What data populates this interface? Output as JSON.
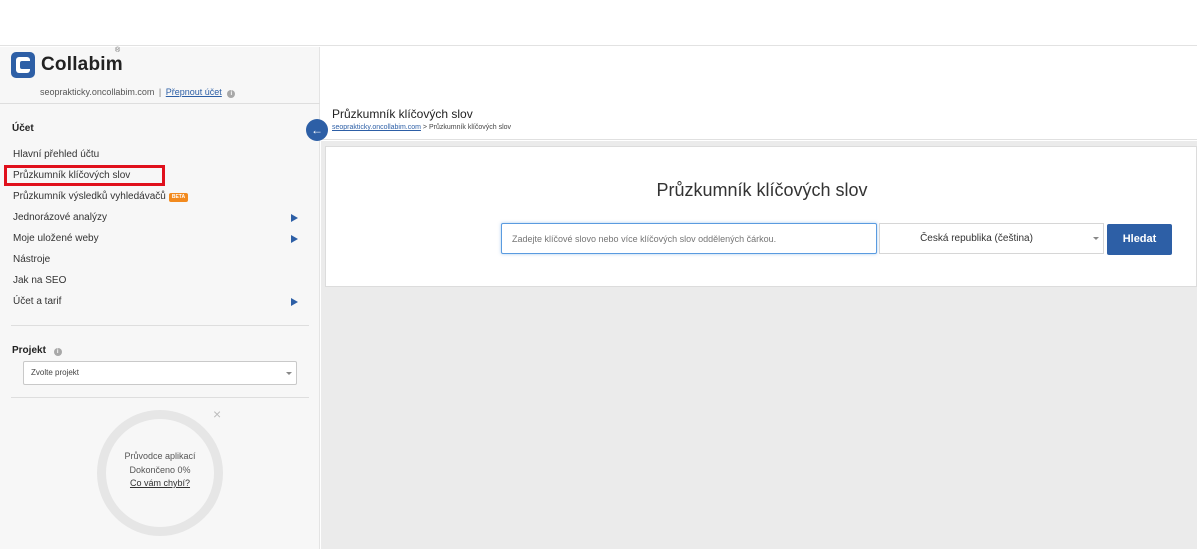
{
  "brand": {
    "name": "Collabim",
    "reg": "®"
  },
  "account": {
    "domain": "seoprakticky.oncollabim.com",
    "separator": "|",
    "switch_label": "Přepnout účet",
    "info_icon": "info-icon"
  },
  "sidebar": {
    "section_title": "Účet",
    "items": [
      {
        "label": "Hlavní přehled účtu",
        "has_arrow": false
      },
      {
        "label": "Průzkumník klíčových slov",
        "has_arrow": false,
        "active": true
      },
      {
        "label": "Průzkumník výsledků vyhledávačů",
        "badge": "BETA"
      },
      {
        "label": "Jednorázové analýzy",
        "has_arrow": true
      },
      {
        "label": "Moje uložené weby",
        "has_arrow": true
      },
      {
        "label": "Nástroje",
        "has_arrow": false
      },
      {
        "label": "Jak na SEO",
        "has_arrow": false
      },
      {
        "label": "Účet a tarif",
        "has_arrow": true
      }
    ],
    "project": {
      "title": "Projekt",
      "select_value": "Zvolte projekt"
    },
    "guide": {
      "line1": "Průvodce aplikací",
      "line2": "Dokončeno 0%",
      "link": "Co vám chybí?",
      "close": "×"
    }
  },
  "header": {
    "title": "Průzkumník klíčových slov",
    "breadcrumb_link": "seoprakticky.oncollabim.com",
    "breadcrumb_sep": " > ",
    "breadcrumb_current": "Průzkumník klíčových slov",
    "back_icon": "←"
  },
  "search_card": {
    "title": "Průzkumník klíčových slov",
    "input_placeholder": "Zadejte klíčové slovo nebo více klíčových slov oddělených čárkou.",
    "country_value": "Česká republika (čeština)",
    "search_label": "Hledat"
  },
  "colors": {
    "accent": "#2d5fa6",
    "highlight": "#e0101c",
    "beta": "#f28a1e"
  }
}
